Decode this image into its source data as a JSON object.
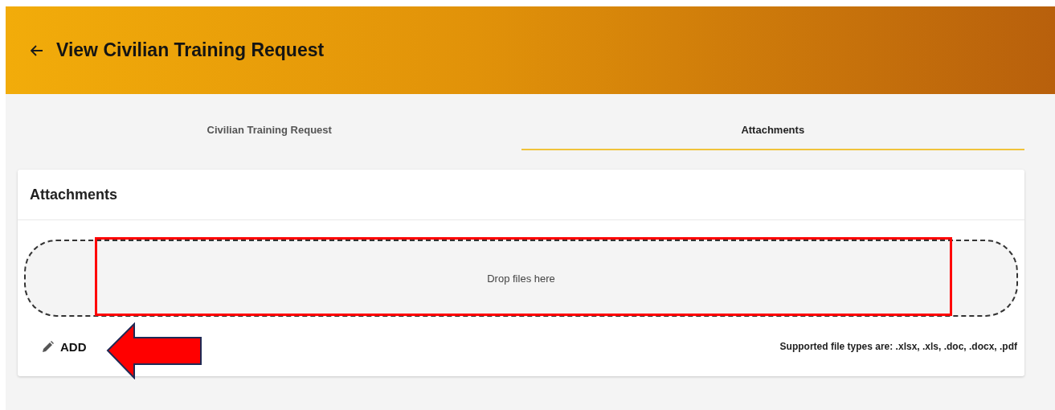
{
  "header": {
    "title": "View Civilian Training Request"
  },
  "tabs": [
    {
      "label": "Civilian Training Request",
      "selected": false
    },
    {
      "label": "Attachments",
      "selected": true
    }
  ],
  "card": {
    "title": "Attachments",
    "dropzone": {
      "text": "Drop files here"
    },
    "add_button": {
      "label": "ADD"
    },
    "supported_types": "Supported file types are: .xlsx, .xls, .doc, .docx, .pdf"
  },
  "annotations": [
    {
      "kind": "frame"
    },
    {
      "kind": "arrow"
    }
  ]
}
